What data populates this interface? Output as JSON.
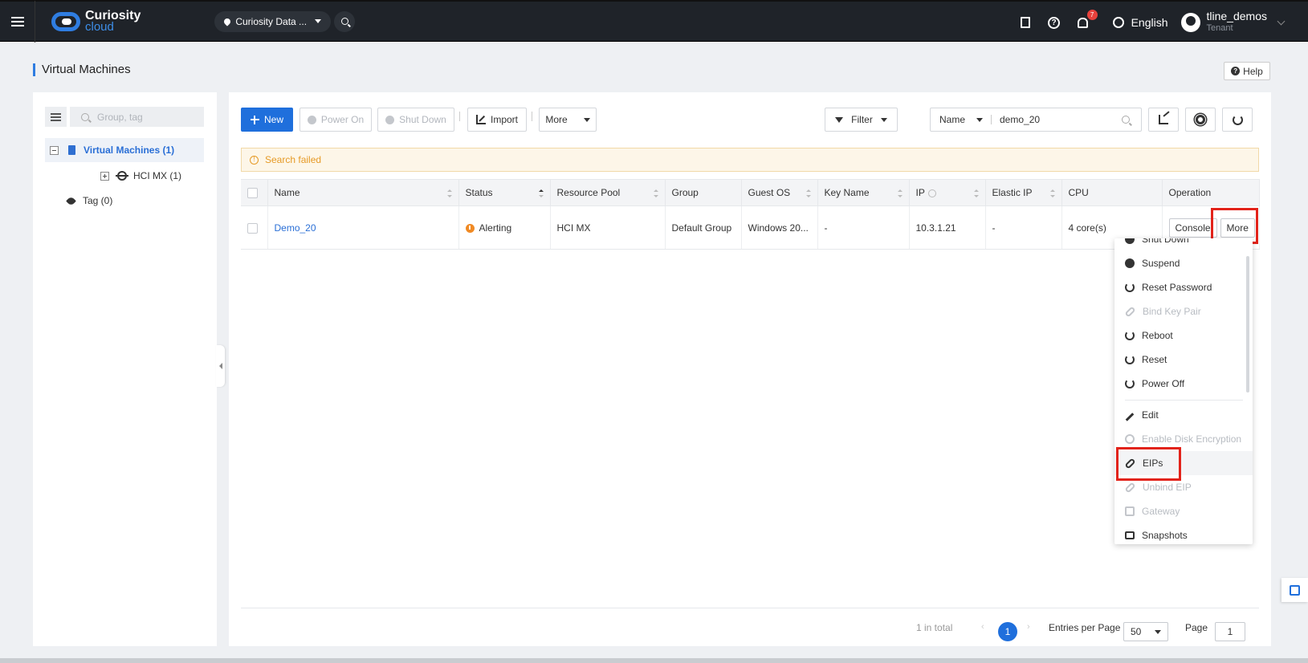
{
  "topbar": {
    "brand_line1": "Curiosity",
    "brand_line2": "cloud",
    "region": "Curiosity Data ...",
    "notification_count": "7",
    "language": "English",
    "username": "tline_demos",
    "role": "Tenant"
  },
  "page": {
    "title": "Virtual Machines",
    "help_label": "Help"
  },
  "tree": {
    "search_placeholder": "Group, tag",
    "root_label": "Virtual Machines (1)",
    "child_label": "HCI MX (1)",
    "tag_label": "Tag (0)"
  },
  "toolbar": {
    "new_label": "New",
    "power_on_label": "Power On",
    "shut_down_label": "Shut Down",
    "import_label": "Import",
    "more_label": "More",
    "filter_label": "Filter",
    "search_field": "Name",
    "search_value": "demo_20"
  },
  "alert": {
    "message": "Search failed"
  },
  "table": {
    "columns": [
      "Name",
      "Status",
      "Resource Pool",
      "Group",
      "Guest OS",
      "Key Name",
      "IP",
      "Elastic IP",
      "CPU",
      "Operation"
    ],
    "rows": [
      {
        "name": "Demo_20",
        "status": "Alerting",
        "resource_pool": "HCI MX",
        "group": "Default Group",
        "guest_os": "Windows 20...",
        "key_name": "-",
        "ip": "10.3.1.21",
        "elastic_ip": "-",
        "cpu": "4 core(s)",
        "console_label": "Console",
        "more_label": "More"
      }
    ]
  },
  "dropdown": {
    "items": [
      {
        "label": "Shut Down",
        "disabled": false
      },
      {
        "label": "Suspend",
        "disabled": false
      },
      {
        "label": "Reset Password",
        "disabled": false
      },
      {
        "label": "Bind Key Pair",
        "disabled": true
      },
      {
        "label": "Reboot",
        "disabled": false
      },
      {
        "label": "Reset",
        "disabled": false
      },
      {
        "label": "Power Off",
        "disabled": false
      },
      {
        "label": "Edit",
        "disabled": false
      },
      {
        "label": "Enable Disk Encryption",
        "disabled": true
      },
      {
        "label": "EIPs",
        "disabled": false
      },
      {
        "label": "Unbind EIP",
        "disabled": true
      },
      {
        "label": "Gateway",
        "disabled": true
      },
      {
        "label": "Snapshots",
        "disabled": false
      }
    ]
  },
  "pagination": {
    "total": "1 in total",
    "current_page": "1",
    "entries_label": "Entries per Page",
    "entries_value": "50",
    "page_label": "Page",
    "page_value": "1"
  },
  "colors": {
    "accent": "#1f6fdc",
    "alert_text": "#e69a26",
    "highlight": "#e2231a"
  }
}
